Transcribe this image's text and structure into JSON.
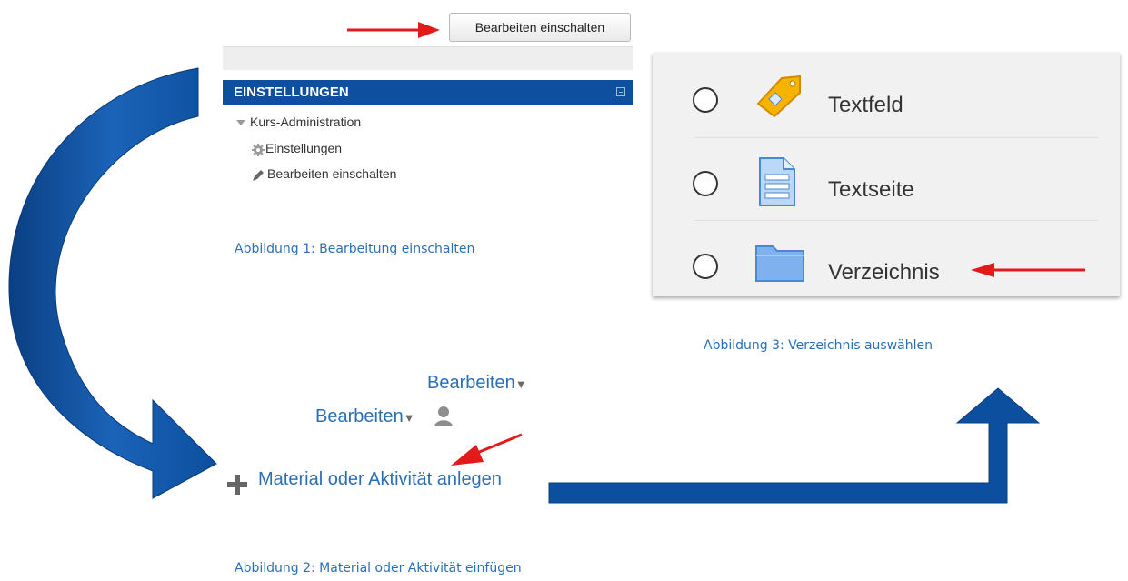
{
  "figure1": {
    "edit_button_label": "Bearbeiten einschalten",
    "settings_block": {
      "title": "EINSTELLUNGEN",
      "tree": {
        "root_label": "Kurs-Administration",
        "items": [
          {
            "icon": "gear-icon",
            "label": "Einstellungen"
          },
          {
            "icon": "pencil-icon",
            "label": "Bearbeiten einschalten"
          }
        ]
      }
    },
    "caption": "Abbildung 1: Bearbeitung einschalten"
  },
  "figure2": {
    "edit_menu_1": "Bearbeiten",
    "edit_menu_2": "Bearbeiten",
    "add_activity_label": "Material oder Aktivität anlegen",
    "caption": "Abbildung 2: Material oder Aktivität einfügen"
  },
  "figure3": {
    "options": [
      {
        "icon": "tag-icon",
        "label": "Textfeld"
      },
      {
        "icon": "page-icon",
        "label": "Textseite"
      },
      {
        "icon": "folder-icon",
        "label": "Verzeichnis"
      }
    ],
    "caption": "Abbildung 3: Verzeichnis auswählen"
  },
  "colors": {
    "header_blue": "#0f4fa0",
    "caption_blue": "#2a6fb5",
    "flow_arrow_blue": "#0c4f9e",
    "pointer_red": "#e11a1a"
  }
}
